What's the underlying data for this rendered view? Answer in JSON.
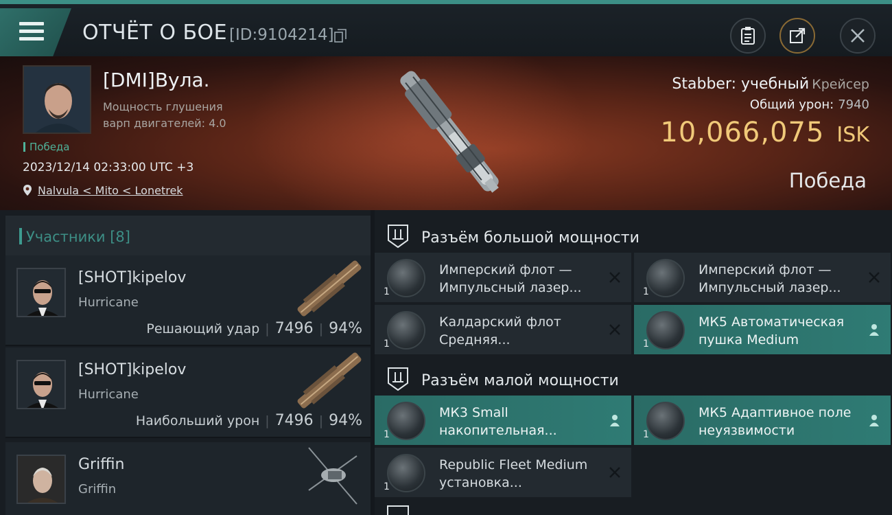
{
  "header": {
    "title": "ОТЧЁТ О БОЕ",
    "report_id": "[ID:9104214]"
  },
  "hero": {
    "pilot_name": "[DMI]Вула.",
    "pilot_stat": "Мощность глушения варп двигателей: 4.0",
    "result": "Победа",
    "datetime": "2023/12/14 02:33:00 UTC +3",
    "location": "Nalvula < Mito < Lonetrek",
    "ship_name": "Stabber: учебный",
    "ship_class": "Крейсер",
    "damage_label": "Общий урон:",
    "damage_value": "7940",
    "isk_value": "10,066,075",
    "isk_unit": "ISK",
    "outcome": "Победа"
  },
  "participants": {
    "title": "Участники [8]",
    "rows": [
      {
        "name": "[SHOT]kipelov",
        "ship": "Hurricane",
        "role": "Решающий удар",
        "damage": "7496",
        "percent": "94%"
      },
      {
        "name": "[SHOT]kipelov",
        "ship": "Hurricane",
        "role": "Наибольший урон",
        "damage": "7496",
        "percent": "94%"
      },
      {
        "name": "Griffin",
        "ship": "Griffin",
        "role": "",
        "damage": "",
        "percent": ""
      }
    ]
  },
  "slots": {
    "high": {
      "title": "Разъём большой мощности",
      "modules": [
        {
          "qty": "1",
          "name": "Имперский флот — Импульсный лазер...",
          "state": "destroyed"
        },
        {
          "qty": "1",
          "name": "Имперский флот — Импульсный лазер...",
          "state": "destroyed"
        },
        {
          "qty": "1",
          "name": "Калдарский флот Средняя...",
          "state": "destroyed"
        },
        {
          "qty": "1",
          "name": "МК5 Автоматическая пушка Medium",
          "state": "dropped"
        }
      ]
    },
    "low": {
      "title": "Разъём малой мощности",
      "modules": [
        {
          "qty": "1",
          "name": "МК3 Small накопительная...",
          "state": "dropped"
        },
        {
          "qty": "1",
          "name": "МК5 Адаптивное поле неуязвимости",
          "state": "dropped"
        },
        {
          "qty": "1",
          "name": "Republic Fleet Medium установка...",
          "state": "destroyed"
        }
      ]
    }
  },
  "colors": {
    "accent": "#3d8f86",
    "isk": "#f0c979",
    "active_module": "#2f7b74"
  }
}
